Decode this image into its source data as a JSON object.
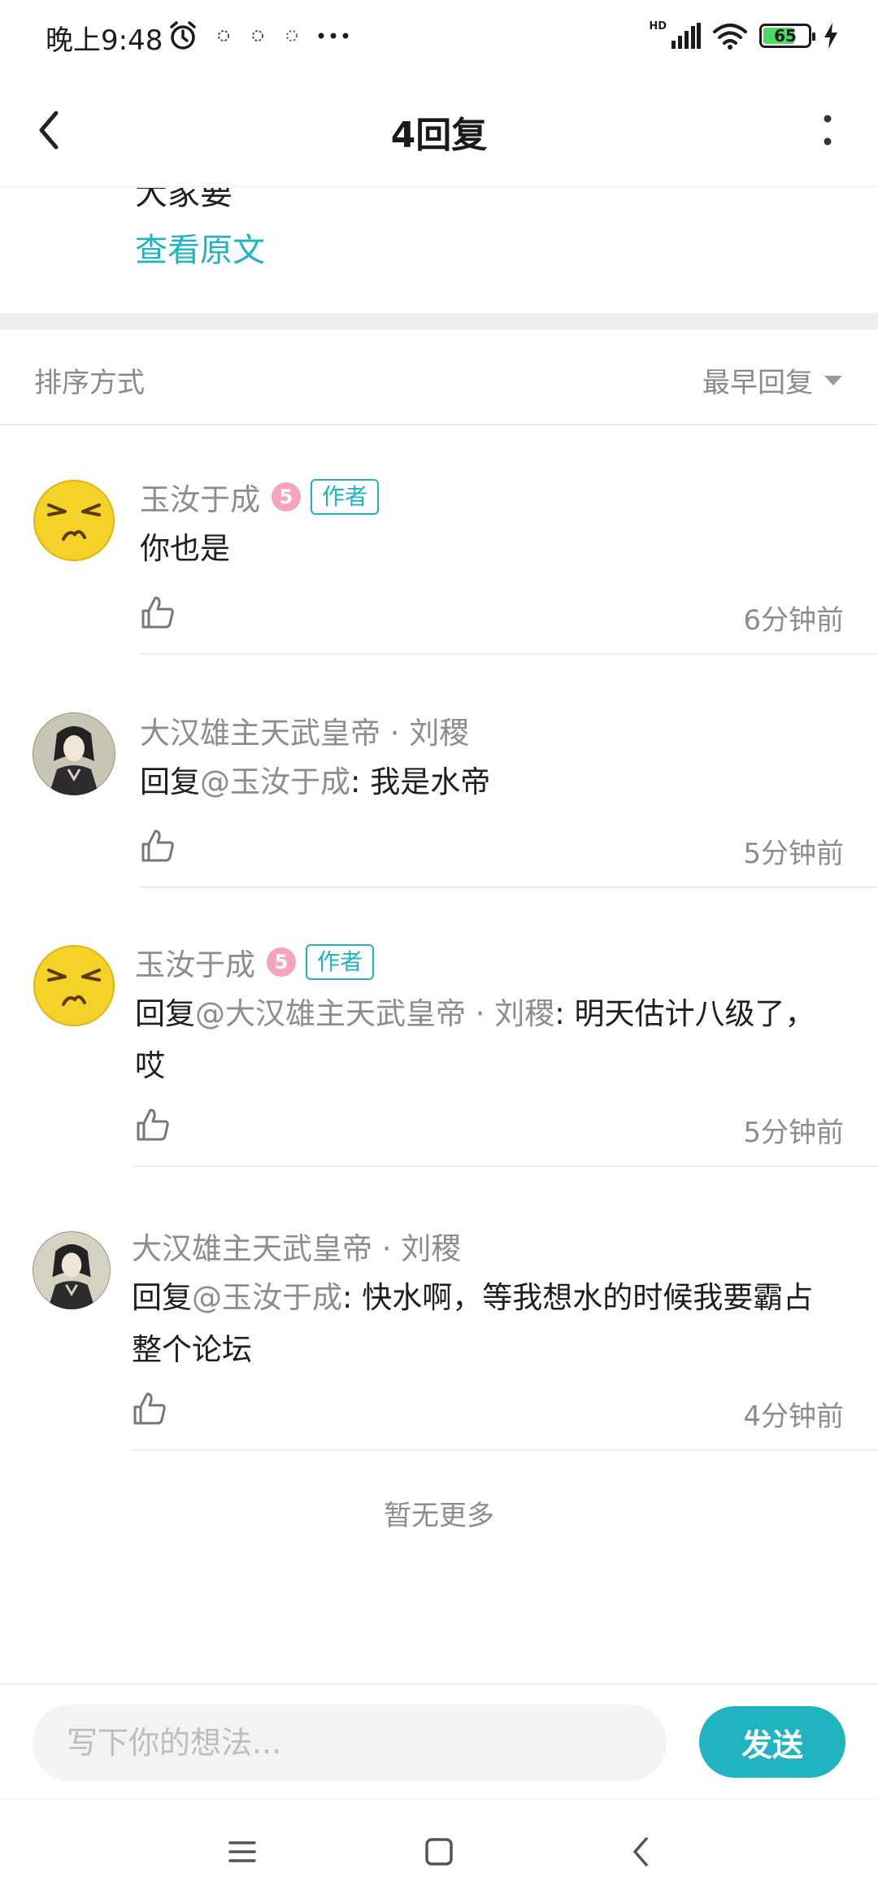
{
  "status_bar": {
    "time": "晚上9:48",
    "network": "HD",
    "battery": "65"
  },
  "nav": {
    "title": "4回复"
  },
  "original_post": {
    "cut_text": "大家要",
    "view_original_label": "查看原文"
  },
  "sort": {
    "label": "排序方式",
    "selected": "最早回复"
  },
  "replies": [
    {
      "author": "玉汝于成",
      "level": "5",
      "tag": "作者",
      "text": "你也是",
      "time": "6分钟前"
    },
    {
      "author": "大汉雄主天武皇帝 · 刘稷",
      "reply_prefix": "回复",
      "mention": "@玉汝于成",
      "text": ": 我是水帝",
      "time": "5分钟前"
    },
    {
      "author": "玉汝于成",
      "level": "5",
      "tag": "作者",
      "reply_prefix": "回复",
      "mention": "@大汉雄主天武皇帝 · 刘稷",
      "text": ": 明天估计八级了，哎",
      "time": "5分钟前"
    },
    {
      "author": "大汉雄主天武皇帝 · 刘稷",
      "reply_prefix": "回复",
      "mention": "@玉汝于成",
      "text": ": 快水啊，等我想水的时候我要霸占整个论坛",
      "time": "4分钟前"
    }
  ],
  "no_more_text": "暂无更多",
  "composer": {
    "placeholder": "写下你的想法...",
    "send_label": "发送"
  },
  "colors": {
    "accent": "#20b3c0",
    "secondary_text": "#8d8d8d",
    "level_badge": "#f6a3bd"
  }
}
